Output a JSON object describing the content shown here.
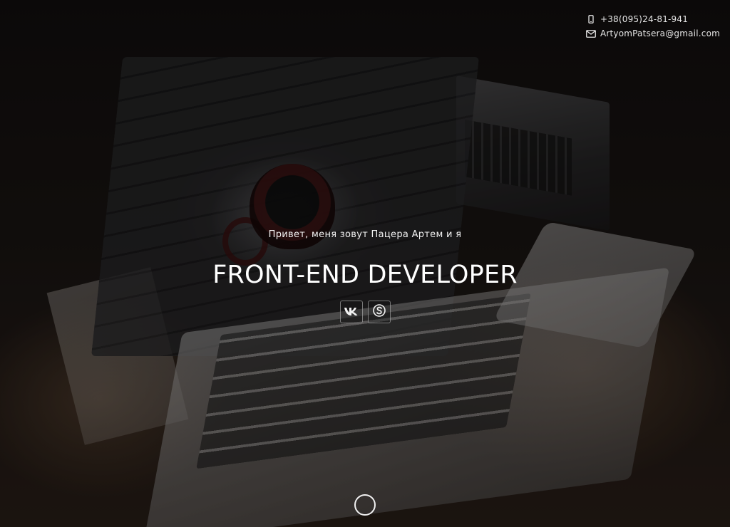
{
  "contacts": {
    "phone": "+38(095)24-81-941",
    "email": "ArtyomPatsera@gmail.com",
    "phone_icon": "mobile-phone-icon",
    "email_icon": "envelope-icon"
  },
  "hero": {
    "intro": "Привет, меня зовут Пацера Артем и я",
    "role": "FRONT-END DEVELOPER"
  },
  "socials": [
    {
      "name": "vk",
      "icon": "vk-icon"
    },
    {
      "name": "skype",
      "icon": "skype-icon"
    }
  ],
  "scroll_indicator": {
    "icon": "circle-icon"
  },
  "colors": {
    "text": "#ffffff",
    "overlay": "#000000"
  }
}
